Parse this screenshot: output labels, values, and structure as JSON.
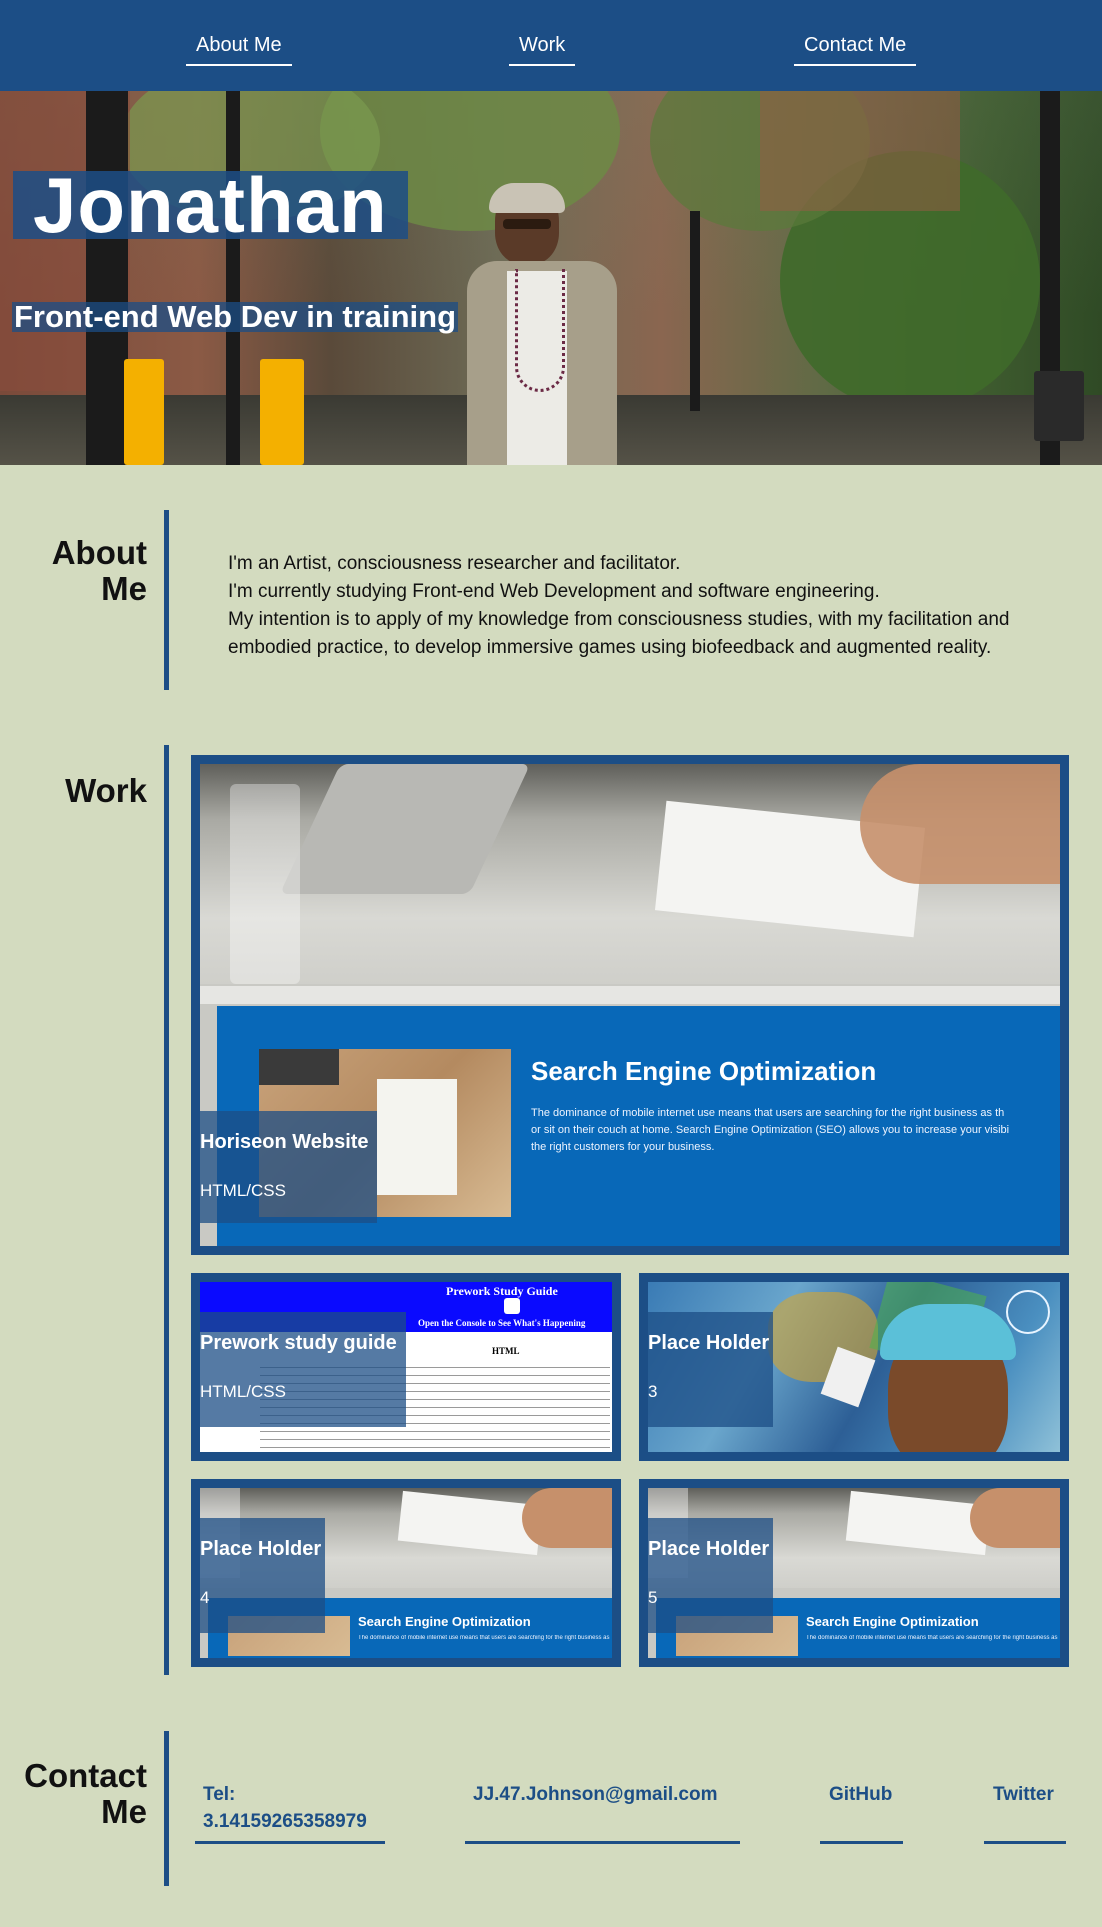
{
  "nav": {
    "items": [
      {
        "label": "About Me"
      },
      {
        "label": "Work"
      },
      {
        "label": "Contact Me"
      }
    ]
  },
  "hero": {
    "name": "Jonathan",
    "tagline": "Front-end Web Dev in training"
  },
  "about": {
    "heading_line1": "About",
    "heading_line2": "Me",
    "lines": [
      "I'm an Artist, consciousness researcher and facilitator.",
      "I'm currently studying Front-end Web Development and software engineering.",
      "My intention is to apply of my knowledge from consciousness studies, with my facilitation and embodied practice, to develop immersive games using biofeedback and augmented reality."
    ]
  },
  "work": {
    "heading": "Work",
    "projects": [
      {
        "title": "Horiseon Website",
        "subtitle": "HTML/CSS"
      },
      {
        "title": "Prework study guide",
        "subtitle": "HTML/CSS"
      },
      {
        "title": "Place Holder",
        "subtitle": "3"
      },
      {
        "title": "Place Holder",
        "subtitle": "4"
      },
      {
        "title": "Place Holder",
        "subtitle": "5"
      }
    ],
    "seo_preview": {
      "title": "Search Engine Optimization",
      "body_lines": [
        "The dominance of mobile internet use means that users are searching for the right business as th",
        "or sit on their couch at home. Search Engine Optimization (SEO) allows you to increase your visibi",
        "the right customers for your business."
      ],
      "small_body": "The dominance of mobile internet use means that users are searching for the right business as th"
    },
    "prework_preview": {
      "header": "Prework Study Guide",
      "banner": "Open the Console to See What's Happening",
      "section": "HTML"
    }
  },
  "contact": {
    "heading_line1": "Contact",
    "heading_line2": "Me",
    "tel_label": "Tel:",
    "tel_number": "3.14159265358979",
    "email": "JJ.47.Johnson@gmail.com",
    "github": "GitHub",
    "twitter": "Twitter"
  },
  "colors": {
    "primary": "#1c4e86",
    "background": "#d3dbbf",
    "preview_blue": "#0868b8"
  }
}
